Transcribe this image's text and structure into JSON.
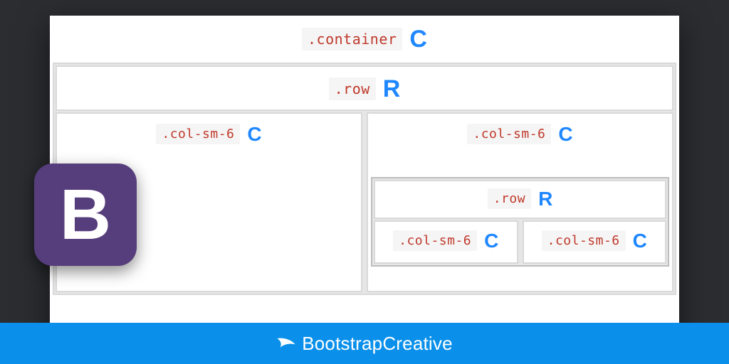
{
  "colors": {
    "accentBlue": "#1f87ff",
    "footerBlue": "#0a90ea",
    "bootstrapPurple": "#563d7c",
    "className": "#c0392b"
  },
  "container": {
    "className": ".container",
    "letter": "C"
  },
  "row": {
    "className": ".row",
    "letter": "R"
  },
  "cols": [
    {
      "className": ".col-sm-6",
      "letter": "C",
      "hasNested": false
    },
    {
      "className": ".col-sm-6",
      "letter": "C",
      "hasNested": true
    }
  ],
  "nested": {
    "row": {
      "className": ".row",
      "letter": "R"
    },
    "cols": [
      {
        "className": ".col-sm-6",
        "letter": "C"
      },
      {
        "className": ".col-sm-6",
        "letter": "C"
      }
    ]
  },
  "badge": {
    "letter": "B"
  },
  "footer": {
    "brand": "BootstrapCreative"
  }
}
